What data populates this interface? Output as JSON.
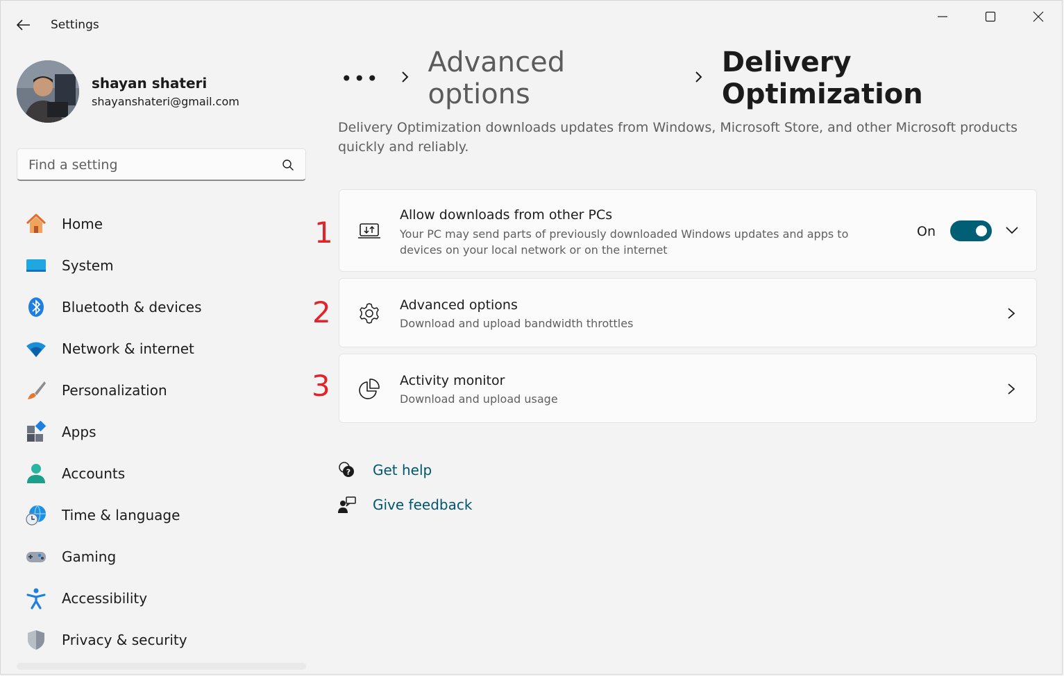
{
  "window": {
    "title": "Settings",
    "controls": {
      "minimize": "minimize-icon",
      "maximize": "maximize-icon",
      "close": "close-icon"
    }
  },
  "profile": {
    "name": "shayan shateri",
    "email": "shayanshateri@gmail.com"
  },
  "search": {
    "placeholder": "Find a setting"
  },
  "sidebar": {
    "items": [
      {
        "label": "Home",
        "icon": "home-icon"
      },
      {
        "label": "System",
        "icon": "system-icon"
      },
      {
        "label": "Bluetooth & devices",
        "icon": "bluetooth-icon"
      },
      {
        "label": "Network & internet",
        "icon": "wifi-icon"
      },
      {
        "label": "Personalization",
        "icon": "brush-icon"
      },
      {
        "label": "Apps",
        "icon": "apps-icon"
      },
      {
        "label": "Accounts",
        "icon": "accounts-icon"
      },
      {
        "label": "Time & language",
        "icon": "globe-clock-icon"
      },
      {
        "label": "Gaming",
        "icon": "gamepad-icon"
      },
      {
        "label": "Accessibility",
        "icon": "accessibility-icon"
      },
      {
        "label": "Privacy & security",
        "icon": "shield-icon"
      }
    ]
  },
  "breadcrumb": {
    "more": "•••",
    "parent": "Advanced options",
    "current": "Delivery Optimization"
  },
  "description": "Delivery Optimization downloads updates from Windows, Microsoft Store, and other Microsoft products quickly and reliably.",
  "cards": [
    {
      "annotation": "1",
      "title": "Allow downloads from other PCs",
      "subtitle_line1": "Your PC may send parts of previously downloaded Windows updates and apps to",
      "subtitle_line2": "devices on your local network or on the internet",
      "toggle_state": "On",
      "toggle_on": true
    },
    {
      "annotation": "2",
      "title": "Advanced options",
      "subtitle": "Download and upload bandwidth throttles"
    },
    {
      "annotation": "3",
      "title": "Activity monitor",
      "subtitle": "Download and upload usage"
    }
  ],
  "help": {
    "get_help": "Get help",
    "give_feedback": "Give feedback"
  },
  "colors": {
    "accent": "#005f74",
    "link": "#00566e",
    "annotation": "#e0242b",
    "background": "#f3f3f3"
  }
}
